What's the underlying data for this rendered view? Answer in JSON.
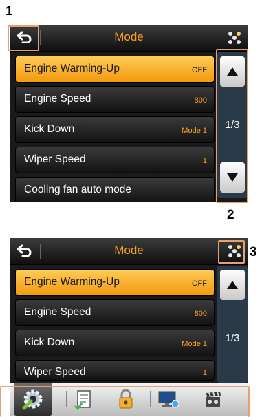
{
  "callouts": [
    "1",
    "2",
    "3"
  ],
  "screen1": {
    "title": "Mode",
    "items": [
      {
        "label": "Engine Warming-Up",
        "value": "OFF",
        "selected": true
      },
      {
        "label": "Engine Speed",
        "value": "800"
      },
      {
        "label": "Kick Down",
        "value": "Mode 1"
      },
      {
        "label": "Wiper Speed",
        "value": "1"
      },
      {
        "label": "Cooling fan auto mode",
        "value": ""
      }
    ],
    "page": "1/3"
  },
  "screen2": {
    "title": "Mode",
    "items": [
      {
        "label": "Engine Warming-Up",
        "value": "OFF",
        "selected": true
      },
      {
        "label": "Engine Speed",
        "value": "800"
      },
      {
        "label": "Kick Down",
        "value": "Mode 1"
      },
      {
        "label": "Wiper Speed",
        "value": "1"
      }
    ],
    "page": "1/3",
    "dock": [
      "settings-gear-icon",
      "checklist-icon",
      "padlock-icon",
      "monitor-icon",
      "film-clapper-icon"
    ]
  },
  "colors": {
    "accent": "#f7a21a",
    "highlight": "#e8a070",
    "scroll_bg": "#2b3a48"
  }
}
